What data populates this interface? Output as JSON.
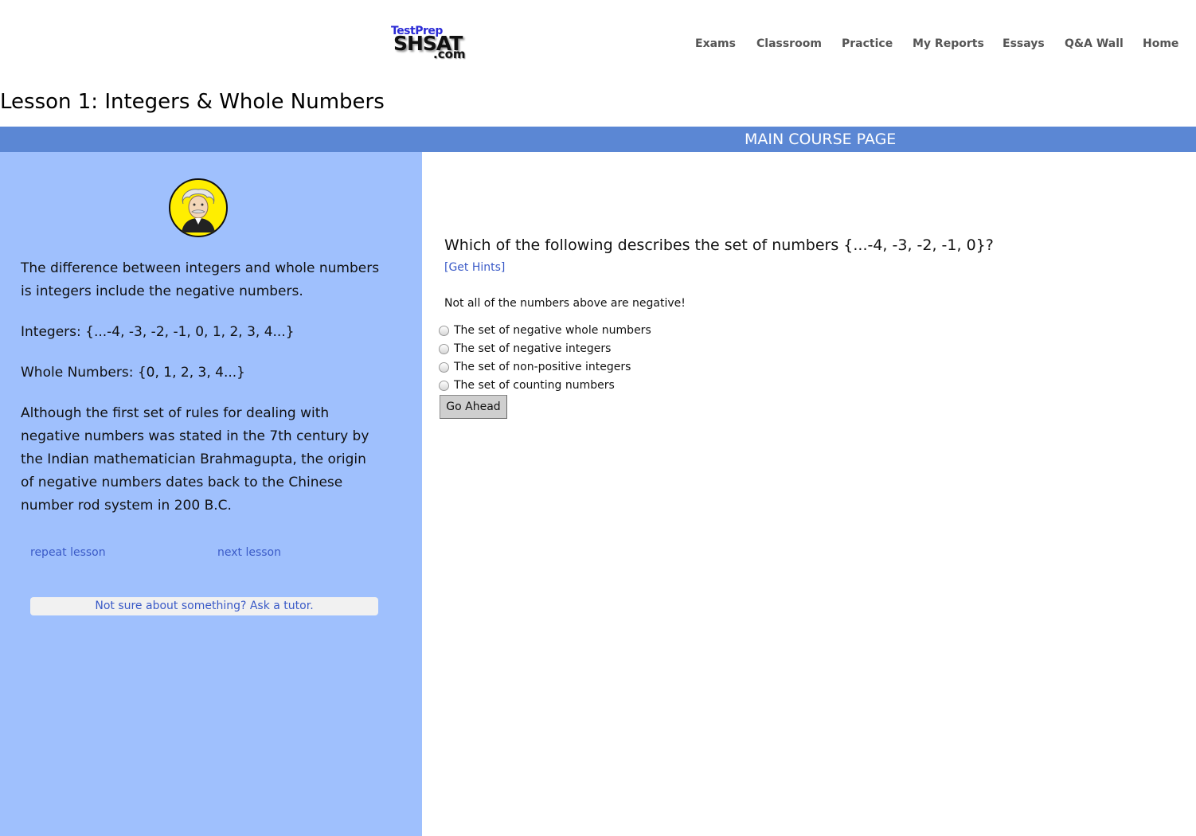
{
  "header": {
    "logo": {
      "line1": "TestPrep",
      "line2": "SHSAT",
      "line3": ".com"
    },
    "nav": [
      "Exams",
      "Classroom",
      "Practice",
      "My Reports",
      "Essays",
      "Q&A Wall",
      "Home"
    ]
  },
  "page_title": "Lesson 1: Integers & Whole Numbers",
  "banner": {
    "label": "MAIN COURSE PAGE",
    "color": "#5b87d4"
  },
  "lesson": {
    "paragraphs": [
      "The difference between integers and whole numbers is integers include the negative numbers.",
      "Integers: {...-4, -3, -2, -1, 0, 1, 2, 3, 4...}",
      "Whole Numbers: {0, 1, 2, 3, 4...}",
      "Although the first set of rules for dealing with negative numbers was stated in the 7th century by the Indian mathematician Brahmagupta, the origin of negative numbers dates back to the Chinese number rod system in 200 B.C."
    ],
    "repeat_link": "repeat lesson",
    "next_link": "next lesson",
    "tutor_link": "Not sure about something? Ask a tutor.",
    "panel_color": "#9fc0fd",
    "avatar_icon": "einstein-avatar-icon"
  },
  "quiz": {
    "question": "Which of the following describes the set of numbers {...-4, -3, -2, -1, 0}?",
    "hints_link": "[Get Hints]",
    "feedback": "Not all of the numbers above are negative!",
    "options": [
      "The set of negative whole numbers",
      "The set of negative integers",
      "The set of non-positive integers",
      "The set of counting numbers"
    ],
    "submit_label": "Go Ahead"
  }
}
